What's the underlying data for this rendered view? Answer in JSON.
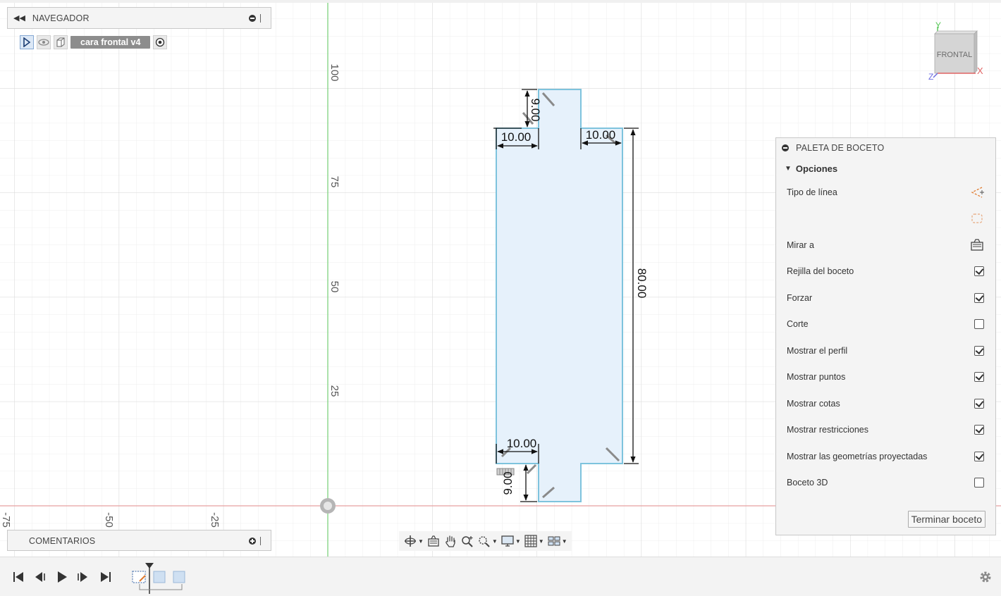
{
  "navigator": {
    "title": "NAVEGADOR",
    "component_name": "cara frontal v4"
  },
  "comments": {
    "title": "COMENTARIOS"
  },
  "viewcube": {
    "face_label": "FRONTAL",
    "axis_x": "X",
    "axis_y": "Y",
    "axis_z": "Z"
  },
  "axes": {
    "vertical_ticks": [
      "100",
      "75",
      "50",
      "25"
    ],
    "horizontal_ticks": [
      "-75",
      "-50",
      "-25"
    ]
  },
  "dimensions": {
    "top_height": "9.00",
    "top_left_width": "10.00",
    "top_right_width": "10.00",
    "total_height": "80.00",
    "bottom_left_width": "10.00",
    "bottom_height": "9.00"
  },
  "palette": {
    "title": "PALETA DE BOCETO",
    "section": "Opciones",
    "rows": [
      {
        "label": "Tipo de línea",
        "control": "icon",
        "icon": "construction-line-icon"
      },
      {
        "label": "",
        "control": "icon",
        "icon": "centerline-icon"
      },
      {
        "label": "Mirar a",
        "control": "icon",
        "icon": "look-at-icon"
      },
      {
        "label": "Rejilla del boceto",
        "control": "checkbox",
        "checked": true
      },
      {
        "label": "Forzar",
        "control": "checkbox",
        "checked": true
      },
      {
        "label": "Corte",
        "control": "checkbox",
        "checked": false
      },
      {
        "label": "Mostrar el perfil",
        "control": "checkbox",
        "checked": true
      },
      {
        "label": "Mostrar puntos",
        "control": "checkbox",
        "checked": true
      },
      {
        "label": "Mostrar cotas",
        "control": "checkbox",
        "checked": true
      },
      {
        "label": "Mostrar restricciones",
        "control": "checkbox",
        "checked": true
      },
      {
        "label": "Mostrar las geometrías proyectadas",
        "control": "checkbox",
        "checked": true
      },
      {
        "label": "Boceto 3D",
        "control": "checkbox",
        "checked": false
      }
    ],
    "finish_button": "Terminar boceto"
  },
  "colors": {
    "grid_minor": "#eeeeee",
    "grid_major": "#d9d9d9",
    "axis_vertical": "#7ed37e",
    "axis_horizontal": "#e8a0a0",
    "profile_fill": "#e6f1fb",
    "profile_stroke": "#7ec3dd",
    "accent": "#e07a2e"
  }
}
